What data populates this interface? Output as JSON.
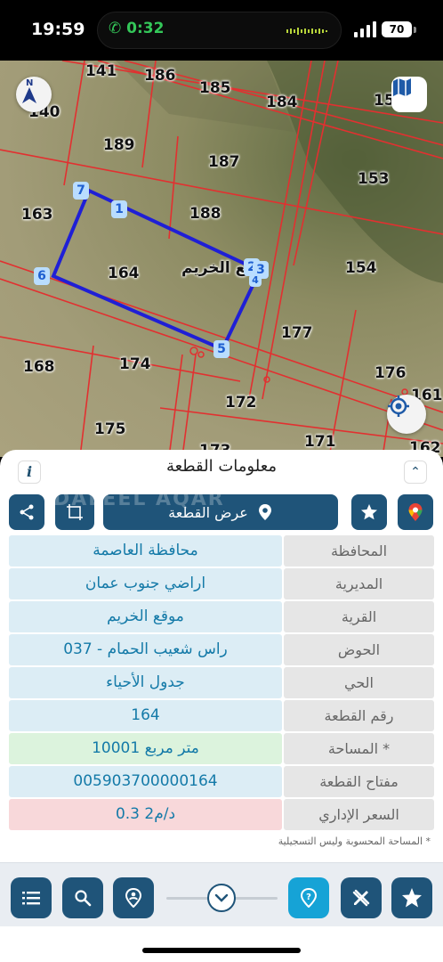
{
  "status": {
    "time": "19:59",
    "call_timer": "0:32",
    "battery": "70"
  },
  "map": {
    "parcels": [
      "141",
      "186",
      "185",
      "184",
      "15",
      "140",
      "189",
      "187",
      "153",
      "163",
      "188",
      "164",
      "154",
      "177",
      "168",
      "174",
      "176",
      "161",
      "172",
      "175",
      "171",
      "162",
      "173"
    ],
    "selected_site_label": "قع الخريم",
    "vertices": [
      "1",
      "2",
      "3",
      "4",
      "5",
      "6",
      "7"
    ],
    "boundary_color": "#1f1fd6",
    "line_color": "#e23030"
  },
  "panel": {
    "title": "معلومات القطعة",
    "info_icon": "i",
    "view_parcel_label": "عرض القطعة",
    "watermark": "DALEEL AQAR",
    "rows": [
      {
        "label": "المحافظة",
        "value": "محافظة العاصمة",
        "tone": "blue"
      },
      {
        "label": "المديرية",
        "value": "اراضي جنوب عمان",
        "tone": "blue"
      },
      {
        "label": "القرية",
        "value": "موقع الخريم",
        "tone": "blue"
      },
      {
        "label": "الحوض",
        "value": "راس شعيب الحمام - 037",
        "tone": "blue"
      },
      {
        "label": "الحي",
        "value": "جدول الأحياء",
        "tone": "blue"
      },
      {
        "label": "رقم القطعة",
        "value": "164",
        "tone": "blue"
      },
      {
        "label": "المساحة *",
        "value": "10001   متر مربع",
        "tone": "green"
      },
      {
        "label": "مفتاح القطعة",
        "value": "005903700000164",
        "tone": "blue"
      },
      {
        "label": "السعر الإداري",
        "value": "0.3 د/م2",
        "tone": "red"
      }
    ],
    "footnote": "* المساحة المحسوبة وليس التسجيلية",
    "accent": "#1f5479"
  }
}
